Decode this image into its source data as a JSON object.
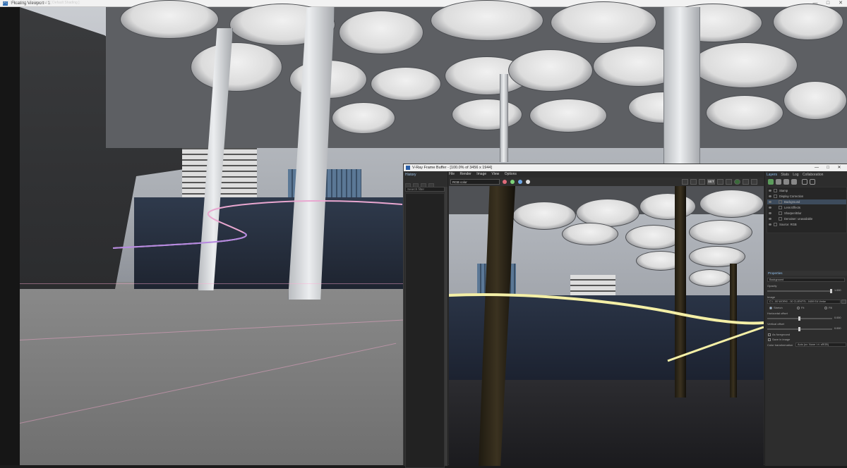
{
  "viewport": {
    "window_title": "Floating Viewport - 1",
    "label": "[+] [ Camera001 ] [ Standard ] [ Default Shading ]",
    "controls": {
      "minimize": "—",
      "maximize": "□",
      "close": "✕"
    }
  },
  "vfb": {
    "window_title": "V-Ray Frame Buffer - [100.0% of 3456 x 1944]",
    "controls": {
      "minimize": "—",
      "maximize": "□",
      "close": "✕"
    },
    "history": {
      "title": "History",
      "search_placeholder": "Search filter"
    },
    "menu": [
      "File",
      "Render",
      "Image",
      "View",
      "Options"
    ],
    "channel": "RGB color",
    "toolbar_badge": "SET",
    "color_dots": [
      "#e06b7a",
      "#7ed47a",
      "#6fa8e8",
      "#e0e0e0"
    ],
    "panel_tabs": [
      "Layers",
      "Stats",
      "Log",
      "Collaboration"
    ],
    "layers": [
      {
        "name": "Stamp",
        "indent": 1,
        "selected": false
      },
      {
        "name": "Display Correction",
        "indent": 1,
        "selected": false
      },
      {
        "name": "Background",
        "indent": 2,
        "selected": true
      },
      {
        "name": "Lens Effects",
        "indent": 2,
        "selected": false
      },
      {
        "name": "Sharpen/Blur",
        "indent": 2,
        "selected": false
      },
      {
        "name": "Denoiser: unavailable",
        "indent": 2,
        "selected": false
      },
      {
        "name": "Source: RGB",
        "indent": 1,
        "selected": false
      }
    ],
    "properties": {
      "title": "Properties",
      "layer_name": "Background",
      "opacity_label": "Opacity",
      "opacity_value": "1.000",
      "image_label": "Image",
      "image_path": "C:\\...00 WORK\\...00 CLIENTS\\...0459 EA Verke",
      "fit_options": [
        "Stretch",
        "Fit",
        "Fill"
      ],
      "fit_selected": "Stretch",
      "h_offset_label": "Horizontal offset",
      "h_offset_value": "0.000",
      "v_offset_label": "Vertical offset",
      "v_offset_value": "0.000",
      "as_foreground_label": "As foreground",
      "save_in_image_label": "Save in image",
      "color_transform_label": "Color transformation",
      "color_transform_value": "Auto (sv: None / rt: sRGB)"
    }
  }
}
